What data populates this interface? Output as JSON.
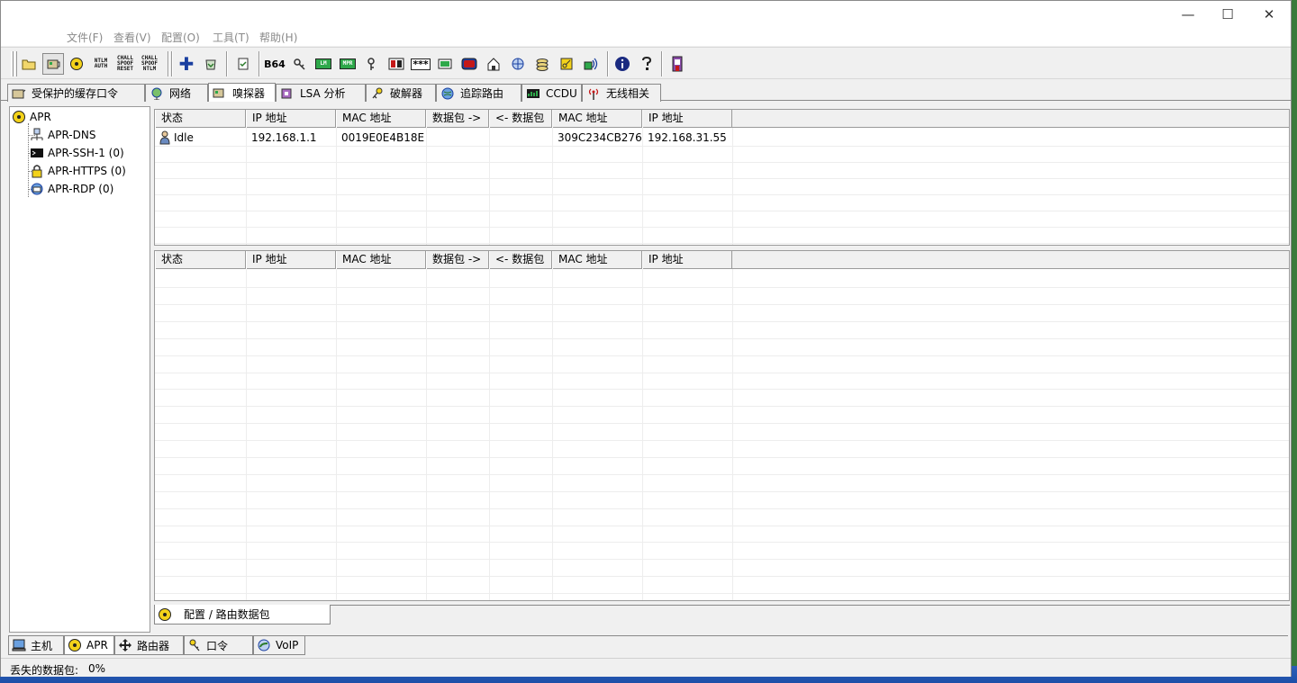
{
  "window": {
    "controls": {
      "minimize": "—",
      "maximize": "☐",
      "close": "✕"
    }
  },
  "menu": [
    {
      "label": "文件(F)"
    },
    {
      "label": "查看(V)"
    },
    {
      "label": "配置(O)"
    },
    {
      "label": "工具(T)"
    },
    {
      "label": "帮助(H)"
    }
  ],
  "toolbar": {
    "ntlm_auth": [
      "NTLM",
      "AUTH"
    ],
    "chall_spoof_reset": [
      "CHALL",
      "SPOOF",
      "RESET"
    ],
    "chall_spoof_ntlm": [
      "CHALL",
      "SPOOF",
      "NTLM"
    ],
    "b64": "B64",
    "lm": "LM",
    "mpr": "MPR",
    "stars": "***",
    "plus": "✚"
  },
  "tabs": [
    {
      "label": "受保护的缓存口令",
      "icon": "cached-password-icon"
    },
    {
      "label": "网络",
      "icon": "network-globe-icon"
    },
    {
      "label": "嗅探器",
      "icon": "sniffer-icon",
      "active": true
    },
    {
      "label": "LSA 分析",
      "icon": "lsa-secrets-icon"
    },
    {
      "label": "破解器",
      "icon": "cracker-key-icon"
    },
    {
      "label": "追踪路由",
      "icon": "traceroute-globe-icon"
    },
    {
      "label": "CCDU",
      "icon": "ccdu-chart-icon"
    },
    {
      "label": "无线相关",
      "icon": "wireless-antenna-icon"
    }
  ],
  "tree": {
    "root": "APR",
    "children": [
      {
        "label": "APR-DNS"
      },
      {
        "label": "APR-SSH-1 (0)"
      },
      {
        "label": "APR-HTTPS (0)"
      },
      {
        "label": "APR-RDP (0)"
      }
    ]
  },
  "upper_table": {
    "columns": [
      "状态",
      "IP 地址",
      "MAC 地址",
      "数据包 ->",
      "<- 数据包",
      "MAC 地址",
      "IP 地址"
    ],
    "rows": [
      {
        "status": "Idle",
        "ip1": "192.168.1.1",
        "mac1": "0019E0E4B18E",
        "pkts_out": "",
        "pkts_in": "",
        "mac2": "309C234CB276",
        "ip2": "192.168.31.55"
      }
    ]
  },
  "lower_table": {
    "columns": [
      "状态",
      "IP 地址",
      "MAC 地址",
      "数据包 ->",
      "<- 数据包",
      "MAC 地址",
      "IP 地址"
    ],
    "rows": []
  },
  "bottom_tab": {
    "label": "配置 / 路由数据包"
  },
  "view_tabs": [
    {
      "label": "主机",
      "icon": "host-computer-icon"
    },
    {
      "label": "APR",
      "icon": "apr-nuclear-icon",
      "active": true
    },
    {
      "label": "路由器",
      "icon": "router-arrows-icon"
    },
    {
      "label": "口令",
      "icon": "password-key-icon"
    },
    {
      "label": "VoIP",
      "icon": "voip-phone-icon"
    }
  ],
  "status": {
    "label": "丢失的数据包:",
    "value": "0%"
  }
}
